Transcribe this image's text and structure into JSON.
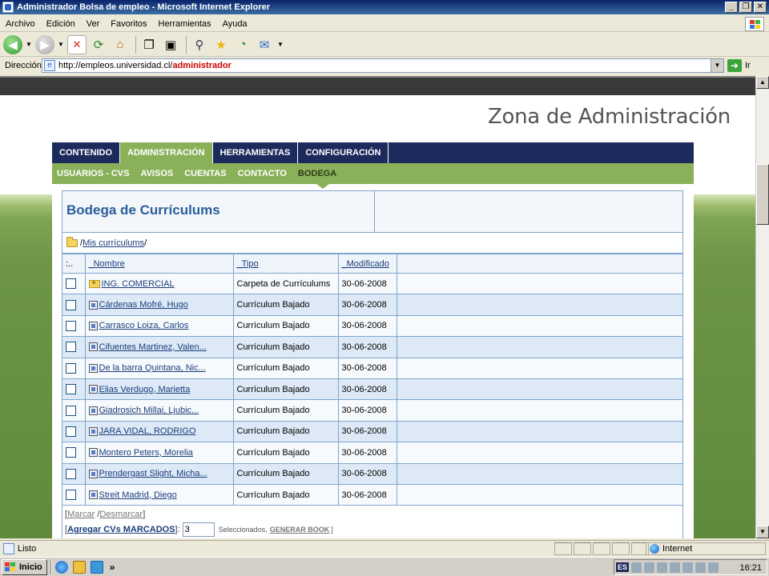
{
  "window": {
    "title": "Administrador Bolsa de empleo - Microsoft Internet Explorer",
    "buttons": [
      "_",
      "❐",
      "✕"
    ]
  },
  "menu": [
    "Archivo",
    "Edición",
    "Ver",
    "Favoritos",
    "Herramientas",
    "Ayuda"
  ],
  "address": {
    "label": "Dirección",
    "url_prefix": "http://empleos.universidad.cl/",
    "url_path": "administrador",
    "go_label": "Ir"
  },
  "page": {
    "heading": "Zona de Administración",
    "nav_primary": [
      "CONTENIDO",
      "ADMINISTRACIÓN",
      "HERRAMIENTAS",
      "CONFIGURACIÓN"
    ],
    "nav_primary_active": "ADMINISTRACIÓN",
    "nav_secondary": [
      "USUARIOS - CVS",
      "AVISOS",
      "CUENTAS",
      "CONTACTO",
      "BODEGA"
    ],
    "nav_secondary_active": "BODEGA",
    "box_title": "Bodega de Currículums",
    "breadcrumb": {
      "pre": "/",
      "link": "Mis currículums",
      "post": "/"
    },
    "table": {
      "headers": [
        ":..",
        "_Nombre",
        "_Tipo",
        "_Modificado"
      ],
      "rows": [
        {
          "icon": "folder-icon",
          "name": "ING. COMERCIAL",
          "type": "Carpeta de Currículums",
          "date": "30-06-2008"
        },
        {
          "icon": "cv-file-icon",
          "name": "Cárdenas Mofré, Hugo",
          "type": "Currículum Bajado",
          "date": "30-06-2008"
        },
        {
          "icon": "cv-file-icon",
          "name": "Carrasco Loiza, Carlos",
          "type": "Currículum Bajado",
          "date": "30-06-2008"
        },
        {
          "icon": "cv-file-icon",
          "name": "Cifuentes Martinez, Valen...",
          "type": "Currículum Bajado",
          "date": "30-06-2008"
        },
        {
          "icon": "cv-file-icon",
          "name": "De la barra Quintana, Nic...",
          "type": "Currículum Bajado",
          "date": "30-06-2008"
        },
        {
          "icon": "cv-file-icon",
          "name": "Elias Verdugo, Marietta",
          "type": "Currículum Bajado",
          "date": "30-06-2008"
        },
        {
          "icon": "cv-file-icon",
          "name": "Giadrosich Millai, Ljubic...",
          "type": "Currículum Bajado",
          "date": "30-06-2008"
        },
        {
          "icon": "cv-file-icon",
          "name": "JARA VIDAL, RODRIGO",
          "type": "Currículum Bajado",
          "date": "30-06-2008"
        },
        {
          "icon": "cv-file-icon",
          "name": "Montero Peters, Morelia",
          "type": "Currículum Bajado",
          "date": "30-06-2008"
        },
        {
          "icon": "cv-file-icon",
          "name": "Prendergast Slight, Micha...",
          "type": "Currículum Bajado",
          "date": "30-06-2008"
        },
        {
          "icon": "cv-file-icon",
          "name": "Streit Madrid, Diego",
          "type": "Currículum Bajado",
          "date": "30-06-2008"
        }
      ]
    },
    "footer": {
      "marcar": "Marcar",
      "desmarcar": "Desmarcar",
      "agregar": "Agregar CVs MARCADOS",
      "count_value": "3",
      "seleccionados": "Seleccionados,",
      "generar": "GENERAR BOOK"
    }
  },
  "status": {
    "text": "Listo",
    "zone": "Internet"
  },
  "taskbar": {
    "start": "Inicio",
    "lang": "ES",
    "clock": "16:21"
  },
  "colors": {
    "nav_dark": "#1d2a5c",
    "nav_green": "#8ab15a",
    "title_blue": "#2a5d99",
    "row_alt": "#dde9f6"
  }
}
